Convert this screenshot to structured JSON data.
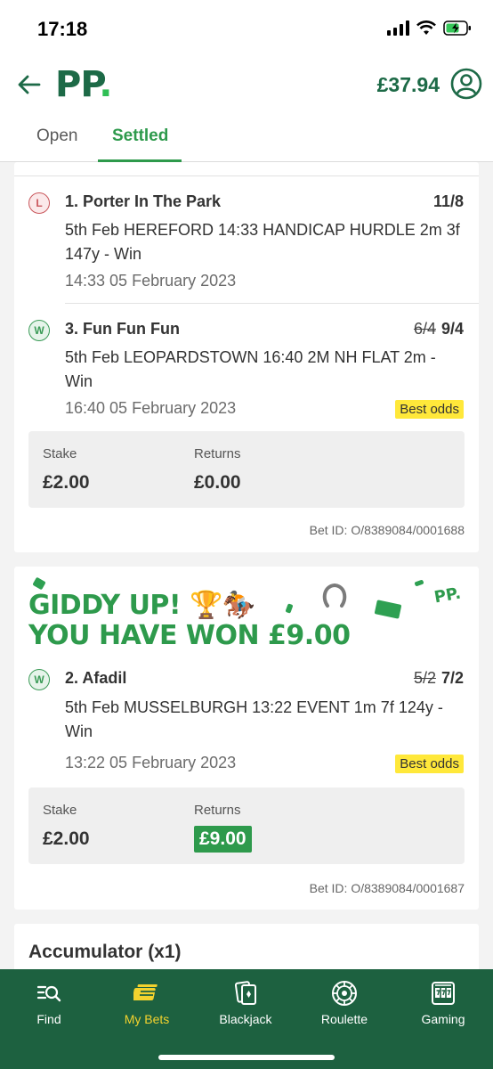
{
  "status_bar": {
    "time": "17:18"
  },
  "header": {
    "logo": "PP",
    "logo_dot": ".",
    "balance": "£37.94"
  },
  "tabs": [
    {
      "label": "Open",
      "active": false
    },
    {
      "label": "Settled",
      "active": true
    }
  ],
  "bet1": {
    "selections": [
      {
        "result": "L",
        "name": "1. Porter In The Park",
        "odds": "11/8",
        "description": "5th Feb HEREFORD 14:33 HANDICAP HURDLE 2m 3f 147y - Win",
        "time": "14:33 05 February 2023"
      },
      {
        "result": "W",
        "name": "3. Fun Fun Fun",
        "old_odds": "6/4",
        "odds": "9/4",
        "description": "5th Feb LEOPARDSTOWN 16:40 2M NH FLAT 2m - Win",
        "time": "16:40 05 February 2023",
        "badge": "Best odds"
      }
    ],
    "stake_label": "Stake",
    "stake": "£2.00",
    "returns_label": "Returns",
    "returns": "£0.00",
    "bet_id": "Bet ID: O/8389084/0001688"
  },
  "bet2": {
    "promo_line1": "GIDDY UP! 🏆🏇",
    "promo_line2": "YOU HAVE WON £9.00",
    "promo_logo": "PP.",
    "selection": {
      "result": "W",
      "name": "2. Afadil",
      "old_odds": "5/2",
      "odds": "7/2",
      "description": "5th Feb MUSSELBURGH 13:22 EVENT 1m 7f 124y - Win",
      "time": "13:22 05 February 2023",
      "badge": "Best odds"
    },
    "stake_label": "Stake",
    "stake": "£2.00",
    "returns_label": "Returns",
    "returns": "£9.00",
    "bet_id": "Bet ID: O/8389084/0001687"
  },
  "bet3": {
    "title": "Accumulator (x1)"
  },
  "bottom_nav": [
    {
      "label": "Find",
      "icon": "search-list-icon",
      "active": false
    },
    {
      "label": "My Bets",
      "icon": "bet-slips-icon",
      "active": true
    },
    {
      "label": "Blackjack",
      "icon": "cards-icon",
      "active": false
    },
    {
      "label": "Roulette",
      "icon": "roulette-icon",
      "active": false
    },
    {
      "label": "Gaming",
      "icon": "slot-machine-icon",
      "active": false
    }
  ],
  "colors": {
    "brand_green": "#1d6a47",
    "accent_green": "#2e9a4c",
    "nav_bg": "#1d6140",
    "nav_active": "#f2d22e",
    "best_odds_bg": "#ffe83a",
    "lost": "#c9565b"
  }
}
